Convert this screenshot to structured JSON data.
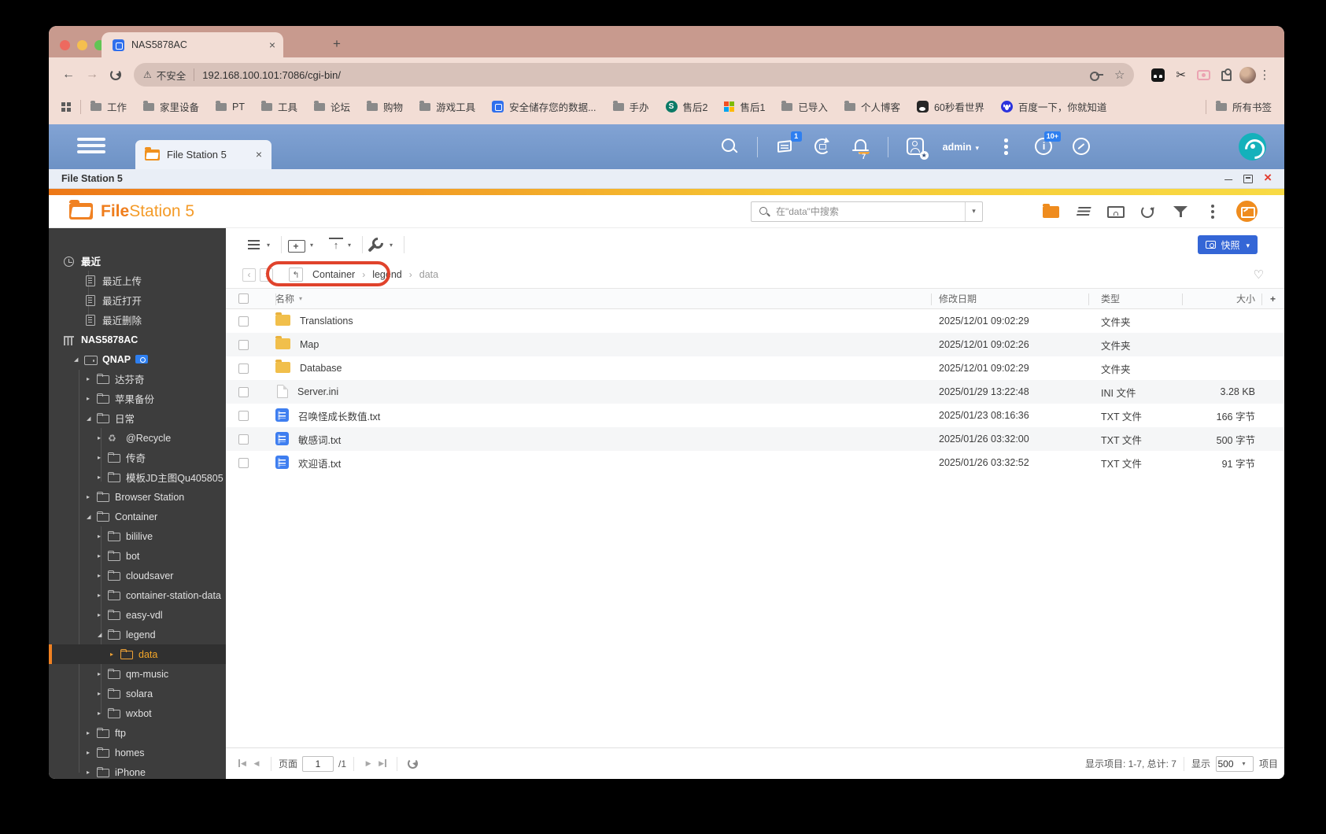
{
  "browser": {
    "tab_title": "NAS5878AC",
    "url": "192.168.100.101:7086/cgi-bin/",
    "security_label": "不安全",
    "bookmarks": [
      {
        "label": "工作",
        "icon": "folder"
      },
      {
        "label": "家里设备",
        "icon": "folder"
      },
      {
        "label": "PT",
        "icon": "folder"
      },
      {
        "label": "工具",
        "icon": "folder"
      },
      {
        "label": "论坛",
        "icon": "folder"
      },
      {
        "label": "购物",
        "icon": "folder"
      },
      {
        "label": "游戏工具",
        "icon": "folder"
      },
      {
        "label": "安全储存您的数据...",
        "icon": "qnap"
      },
      {
        "label": "手办",
        "icon": "folder"
      },
      {
        "label": "售后2",
        "icon": "sharepoint"
      },
      {
        "label": "售后1",
        "icon": "microsoft"
      },
      {
        "label": "已导入",
        "icon": "folder"
      },
      {
        "label": "个人博客",
        "icon": "folder"
      },
      {
        "label": "60秒看世界",
        "icon": "panda"
      },
      {
        "label": "百度一下，你就知道",
        "icon": "baidu"
      }
    ],
    "all_bookmarks_label": "所有书签"
  },
  "qnap_bar": {
    "app_tab_label": "File Station 5",
    "task_badge": "1",
    "notification_badge": "7",
    "user_label": "admin",
    "info_badge": "10+"
  },
  "fs": {
    "window_title": "File Station 5",
    "logo_primary": "File",
    "logo_secondary": "Station 5",
    "search_placeholder": "在\"data\"中搜索",
    "snapshot_label": "快照",
    "breadcrumb": {
      "items": [
        "Container",
        "legend",
        "data"
      ]
    },
    "columns": {
      "name": "名称",
      "modified": "修改日期",
      "type": "类型",
      "size": "大小"
    },
    "rows": [
      {
        "icon": "folder",
        "name": "Translations",
        "modified": "2025/12/01 09:02:29",
        "type": "文件夹",
        "size": ""
      },
      {
        "icon": "folder",
        "name": "Map",
        "modified": "2025/12/01 09:02:26",
        "type": "文件夹",
        "size": ""
      },
      {
        "icon": "folder",
        "name": "Database",
        "modified": "2025/12/01 09:02:29",
        "type": "文件夹",
        "size": ""
      },
      {
        "icon": "ini",
        "name": "Server.ini",
        "modified": "2025/01/29 13:22:48",
        "type": "INI 文件",
        "size": "3.28 KB"
      },
      {
        "icon": "txt",
        "name": "召唤怪成长数值.txt",
        "modified": "2025/01/23 08:16:36",
        "type": "TXT 文件",
        "size": "166 字节"
      },
      {
        "icon": "txt",
        "name": "敏感词.txt",
        "modified": "2025/01/26 03:32:00",
        "type": "TXT 文件",
        "size": "500 字节"
      },
      {
        "icon": "txt",
        "name": "欢迎语.txt",
        "modified": "2025/01/26 03:32:52",
        "type": "TXT 文件",
        "size": "91 字节"
      }
    ],
    "statusbar": {
      "page_label": "页面",
      "page_value": "1",
      "page_total": "/1",
      "items_info": "显示项目: 1-7, 总计: 7",
      "show_label": "显示",
      "page_size": "500",
      "items_label": "项目"
    }
  },
  "sidebar": {
    "items": [
      {
        "label": "最近",
        "level": 0,
        "icon": "clock",
        "bold": true
      },
      {
        "label": "最近上传",
        "level": 1,
        "icon": "list"
      },
      {
        "label": "最近打开",
        "level": 1,
        "icon": "list"
      },
      {
        "label": "最近删除",
        "level": 1,
        "icon": "list"
      },
      {
        "label": "NAS5878AC",
        "level": 0,
        "icon": "nas",
        "bold": true
      },
      {
        "label": "QNAP",
        "level": 1,
        "icon": "disk",
        "arrow": "exp",
        "badge": "camera",
        "bold": true
      },
      {
        "label": "达芬奇",
        "level": 2,
        "icon": "folder",
        "arrow": "col"
      },
      {
        "label": "苹果备份",
        "level": 2,
        "icon": "folder",
        "arrow": "col"
      },
      {
        "label": "日常",
        "level": 2,
        "icon": "folder",
        "arrow": "exp"
      },
      {
        "label": "@Recycle",
        "level": 3,
        "icon": "recycle",
        "arrow": "col"
      },
      {
        "label": "传奇",
        "level": 3,
        "icon": "folder",
        "arrow": "col"
      },
      {
        "label": "模板JD主图Qu405805",
        "level": 3,
        "icon": "folder",
        "arrow": "col"
      },
      {
        "label": "Browser Station",
        "level": 2,
        "icon": "folder",
        "arrow": "col"
      },
      {
        "label": "Container",
        "level": 2,
        "icon": "folder",
        "arrow": "exp"
      },
      {
        "label": "bililive",
        "level": 3,
        "icon": "folder",
        "arrow": "col"
      },
      {
        "label": "bot",
        "level": 3,
        "icon": "folder",
        "arrow": "col"
      },
      {
        "label": "cloudsaver",
        "level": 3,
        "icon": "folder",
        "arrow": "col"
      },
      {
        "label": "container-station-data",
        "level": 3,
        "icon": "folder",
        "arrow": "col"
      },
      {
        "label": "easy-vdl",
        "level": 3,
        "icon": "folder",
        "arrow": "col"
      },
      {
        "label": "legend",
        "level": 3,
        "icon": "folder",
        "arrow": "exp"
      },
      {
        "label": "data",
        "level": 4,
        "icon": "folder",
        "arrow": "col",
        "selected": true
      },
      {
        "label": "qm-music",
        "level": 3,
        "icon": "folder",
        "arrow": "col"
      },
      {
        "label": "solara",
        "level": 3,
        "icon": "folder",
        "arrow": "col"
      },
      {
        "label": "wxbot",
        "level": 3,
        "icon": "folder",
        "arrow": "col"
      },
      {
        "label": "ftp",
        "level": 2,
        "icon": "folder",
        "arrow": "col"
      },
      {
        "label": "homes",
        "level": 2,
        "icon": "folder",
        "arrow": "col"
      },
      {
        "label": "iPhone",
        "level": 2,
        "icon": "folder",
        "arrow": "col"
      }
    ]
  }
}
